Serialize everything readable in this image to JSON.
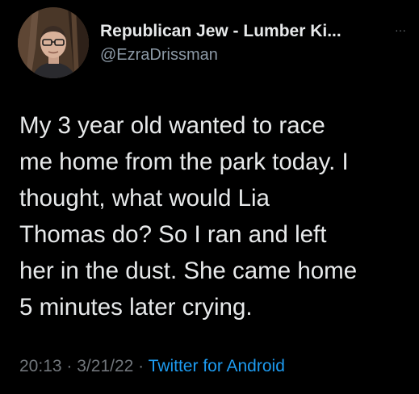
{
  "tweet": {
    "author": {
      "display_name": "Republican Jew - Lumber Ki...",
      "handle": "@EzraDrissman",
      "avatar_icon": "profile-photo"
    },
    "more_icon": "more-options-icon",
    "more_label": "···",
    "text_lines": [
      "My 3 year old wanted to race",
      "me home from the park today. I",
      "thought, what would Lia",
      "Thomas do? So I ran and left",
      "her in the dust. She came home",
      "5 minutes later crying."
    ],
    "time": "20:13",
    "separator": "·",
    "date": "3/21/22",
    "source": "Twitter for Android"
  },
  "colors": {
    "background": "#000000",
    "primary_text": "#e7e9ea",
    "secondary_text": "#71767b",
    "link": "#1d9bf0"
  }
}
